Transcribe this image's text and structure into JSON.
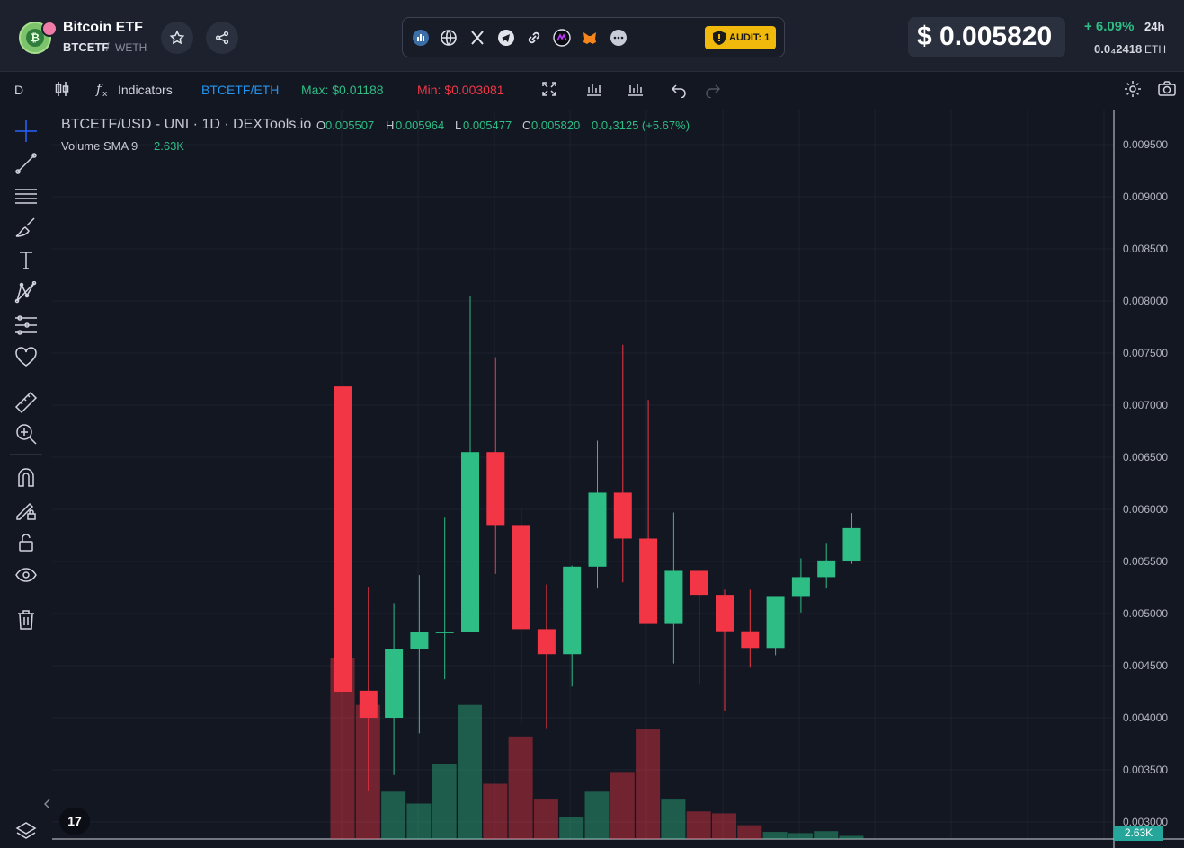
{
  "header": {
    "token_name": "Bitcoin ETF",
    "pair_base": "BTCETF",
    "pair_separator": "/",
    "pair_quote": "WETH",
    "audit_label": "AUDIT: 1",
    "price_usd": "$ 0.005820",
    "change_24h": "+ 6.09%",
    "change_period": "24h",
    "price_eth": "0.0₄2418",
    "price_eth_unit": "ETH",
    "icons": [
      "dextools-icon",
      "globe-icon",
      "x-icon",
      "telegram-icon",
      "link-icon",
      "audit-icon",
      "metamask-icon",
      "more-icon"
    ],
    "colors": {
      "up": "#2ebd85",
      "down": "#f23645",
      "audit": "#f0b90b"
    }
  },
  "toolbar": {
    "interval": "D",
    "indicators_label": "Indicators",
    "pair_toggle": "BTCETF/ETH",
    "max_label": "Max: $0.01188",
    "min_label": "Min: $0.003081"
  },
  "legend": {
    "symbol": "BTCETF/USD - UNI · 1D · DEXTools.io",
    "o_label": "O",
    "o_value": "0.005507",
    "h_label": "H",
    "h_value": "0.005964",
    "l_label": "L",
    "l_value": "0.005477",
    "c_label": "C",
    "c_value": "0.005820",
    "change": "0.0₄3125 (+5.67%)",
    "volume_label": "Volume SMA 9",
    "volume_value": "2.63K",
    "volume_tag": "2.63K",
    "tv_logo": "17"
  },
  "chart_data": {
    "type": "candlestick",
    "ylim": [
      0.00295,
      0.00975
    ],
    "y_ticks": [
      "0.003000",
      "0.003500",
      "0.004000",
      "0.004500",
      "0.005000",
      "0.005500",
      "0.006000",
      "0.006500",
      "0.007000",
      "0.007500",
      "0.008000",
      "0.008500",
      "0.009000",
      "0.009500"
    ],
    "candles": [
      {
        "o": 0.00718,
        "h": 0.00767,
        "l": 0.00425,
        "c": 0.00425
      },
      {
        "o": 0.00426,
        "h": 0.00525,
        "l": 0.0033,
        "c": 0.004
      },
      {
        "o": 0.004,
        "h": 0.0051,
        "l": 0.00345,
        "c": 0.00466
      },
      {
        "o": 0.00466,
        "h": 0.00537,
        "l": 0.00385,
        "c": 0.00482
      },
      {
        "o": 0.00482,
        "h": 0.00592,
        "l": 0.00437,
        "c": 0.00482
      },
      {
        "o": 0.00482,
        "h": 0.00805,
        "l": 0.00482,
        "c": 0.00655
      },
      {
        "o": 0.00655,
        "h": 0.00746,
        "l": 0.00538,
        "c": 0.00585
      },
      {
        "o": 0.00585,
        "h": 0.00602,
        "l": 0.00395,
        "c": 0.00485
      },
      {
        "o": 0.00485,
        "h": 0.00528,
        "l": 0.0039,
        "c": 0.00461
      },
      {
        "o": 0.00461,
        "h": 0.00546,
        "l": 0.0043,
        "c": 0.00545
      },
      {
        "o": 0.00545,
        "h": 0.00666,
        "l": 0.00524,
        "c": 0.00616
      },
      {
        "o": 0.00616,
        "h": 0.00758,
        "l": 0.0053,
        "c": 0.00572
      },
      {
        "o": 0.00572,
        "h": 0.00705,
        "l": 0.0049,
        "c": 0.0049
      },
      {
        "o": 0.0049,
        "h": 0.00597,
        "l": 0.00452,
        "c": 0.00541
      },
      {
        "o": 0.00541,
        "h": 0.00541,
        "l": 0.00433,
        "c": 0.00518
      },
      {
        "o": 0.00518,
        "h": 0.00523,
        "l": 0.00406,
        "c": 0.00483
      },
      {
        "o": 0.00483,
        "h": 0.00523,
        "l": 0.00448,
        "c": 0.00467
      },
      {
        "o": 0.00467,
        "h": 0.00516,
        "l": 0.0046,
        "c": 0.00516
      },
      {
        "o": 0.00516,
        "h": 0.00553,
        "l": 0.00501,
        "c": 0.00535
      },
      {
        "o": 0.00535,
        "h": 0.00567,
        "l": 0.00524,
        "c": 0.00551
      },
      {
        "o": 0.005507,
        "h": 0.005964,
        "l": 0.005477,
        "c": 0.00582
      }
    ],
    "volume": [
      4.6,
      3.4,
      1.2,
      0.9,
      1.9,
      3.4,
      1.4,
      2.6,
      1.0,
      0.55,
      1.2,
      1.7,
      2.8,
      1.0,
      0.7,
      0.65,
      0.35,
      0.18,
      0.15,
      0.2,
      0.08
    ],
    "volume_max": 4.6
  }
}
